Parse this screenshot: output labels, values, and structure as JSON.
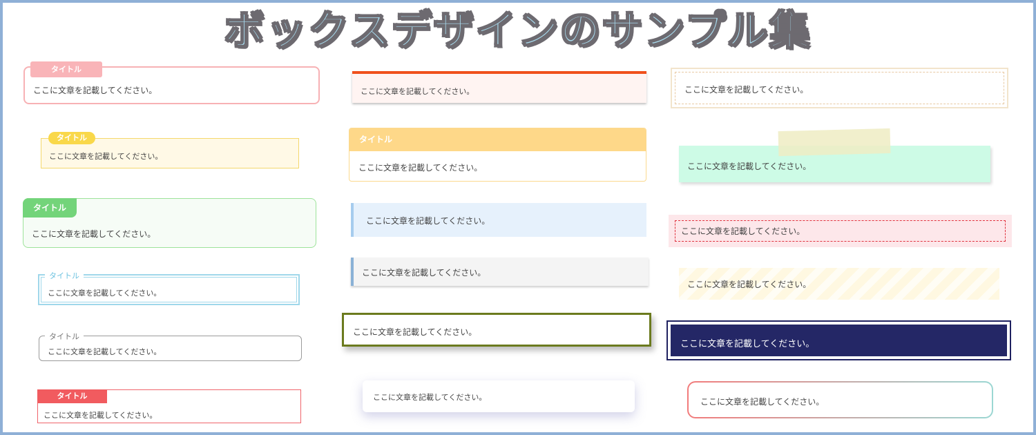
{
  "title": "ボックスデザインのサンプル集",
  "sample_text": "ここに文章を記載してください。",
  "label": "タイトル",
  "left_column": [
    {
      "label": "タイトル",
      "text": "ここに文章を記載してください。"
    },
    {
      "label": "タイトル",
      "text": "ここに文章を記載してください。"
    },
    {
      "label": "タイトル",
      "text": "ここに文章を記載してください。"
    },
    {
      "label": "タイトル",
      "text": "ここに文章を記載してください。"
    },
    {
      "label": "タイトル",
      "text": "ここに文章を記載してください。"
    },
    {
      "label": "タイトル",
      "text": "ここに文章を記載してください。"
    }
  ],
  "middle_column": [
    {
      "text": "ここに文章を記載してください。"
    },
    {
      "label": "タイトル",
      "text": "ここに文章を記載してください。"
    },
    {
      "text": "ここに文章を記載してください。"
    },
    {
      "text": "ここに文章を記載してください。"
    },
    {
      "text": "ここに文章を記載してください。"
    },
    {
      "text": "ここに文章を記載してください。"
    }
  ],
  "right_column": [
    {
      "text": "ここに文章を記載してください。"
    },
    {
      "text": "ここに文章を記載してください。"
    },
    {
      "text": "ここに文章を記載してください。"
    },
    {
      "text": "ここに文章を記載してください。"
    },
    {
      "text": "ここに文章を記載してください。"
    },
    {
      "text": "ここに文章を記載してください。"
    }
  ],
  "colors": {
    "frame": "#8fb0d6",
    "title_fill": "#a9dcef",
    "title_outline": "#6d6a70",
    "pink": "#f9b4b8",
    "yellow": "#f9d84a",
    "green": "#73d47a",
    "light_blue": "#9fd7ea",
    "red": "#f15b5f",
    "orange": "#f0501c",
    "olive": "#6b7a1e",
    "navy": "#242766"
  }
}
